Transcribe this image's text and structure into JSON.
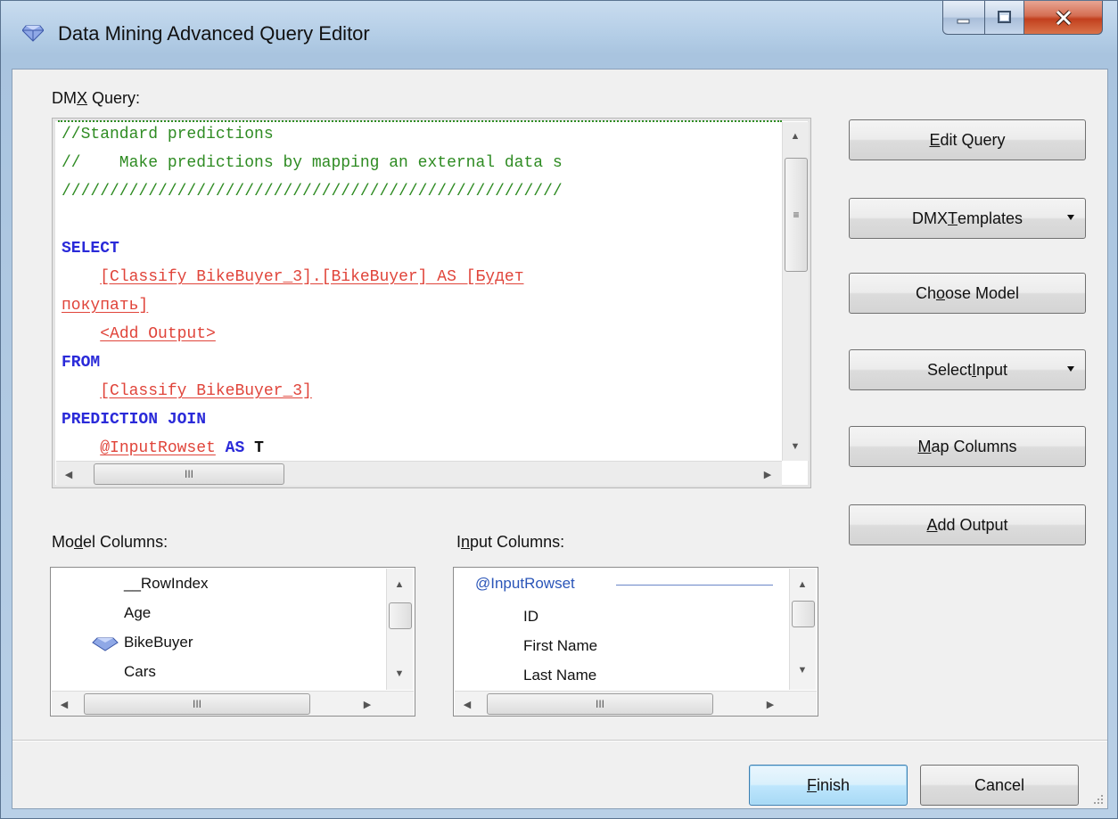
{
  "window": {
    "title": "Data Mining Advanced Query Editor"
  },
  "query": {
    "label_prefix": "DM",
    "label_underlined": "X",
    "label_suffix": " Query:",
    "lines": [
      {
        "parts": [
          {
            "cls": "cmt",
            "text": "//Standard predictions"
          }
        ]
      },
      {
        "parts": [
          {
            "cls": "cmt",
            "text": "//    Make predictions by mapping an external data s"
          }
        ]
      },
      {
        "parts": [
          {
            "cls": "cmt",
            "text": "////////////////////////////////////////////////////"
          }
        ]
      },
      {
        "parts": [
          {
            "cls": "cmt",
            "text": ""
          }
        ]
      },
      {
        "parts": [
          {
            "cls": "kw",
            "text": "SELECT"
          }
        ]
      },
      {
        "parts": [
          {
            "cls": "plain",
            "text": "    "
          },
          {
            "cls": "obj",
            "text": "[Classify BikeBuyer_3].[BikeBuyer] AS [Будет"
          }
        ]
      },
      {
        "parts": [
          {
            "cls": "obj",
            "text": "покупать]"
          }
        ]
      },
      {
        "parts": [
          {
            "cls": "plain",
            "text": "    "
          },
          {
            "cls": "obj",
            "text": "<Add Output>"
          }
        ]
      },
      {
        "parts": [
          {
            "cls": "kw",
            "text": "FROM"
          }
        ]
      },
      {
        "parts": [
          {
            "cls": "plain",
            "text": "    "
          },
          {
            "cls": "obj",
            "text": "[Classify BikeBuyer_3]"
          }
        ]
      },
      {
        "parts": [
          {
            "cls": "kw",
            "text": "PREDICTION JOIN"
          }
        ]
      },
      {
        "parts": [
          {
            "cls": "plain",
            "text": "    "
          },
          {
            "cls": "obj",
            "text": "@InputRowset"
          },
          {
            "cls": "kw",
            "text": " AS "
          },
          {
            "cls": "plain",
            "text": "T"
          }
        ]
      }
    ]
  },
  "buttons": {
    "edit_query": {
      "pre": "",
      "u": "E",
      "post": "dit Query"
    },
    "dmx_templates": {
      "pre": "DMX ",
      "u": "T",
      "post": "emplates"
    },
    "choose_model": {
      "pre": "Ch",
      "u": "o",
      "post": "ose Model"
    },
    "select_input": {
      "pre": "Select ",
      "u": "I",
      "post": "nput"
    },
    "map_columns": {
      "pre": "",
      "u": "M",
      "post": "ap Columns"
    },
    "add_output": {
      "pre": "",
      "u": "A",
      "post": "dd Output"
    },
    "finish": {
      "pre": "",
      "u": "F",
      "post": "inish"
    },
    "cancel": {
      "pre": "Cancel",
      "u": "",
      "post": ""
    }
  },
  "model_columns": {
    "label_pre": "Mo",
    "label_u": "d",
    "label_post": "el Columns:",
    "items": [
      "__RowIndex",
      "Age",
      "BikeBuyer",
      "Cars"
    ]
  },
  "input_columns": {
    "label_pre": "I",
    "label_u": "n",
    "label_post": "put Columns:",
    "header": "@InputRowset",
    "items": [
      "ID",
      "First Name",
      "Last Name"
    ]
  },
  "scroll_grip": "III",
  "colors": {
    "comment": "#2e8b22",
    "keyword": "#2a2ad9",
    "object": "#e0443a",
    "header_link": "#2a55b8"
  }
}
